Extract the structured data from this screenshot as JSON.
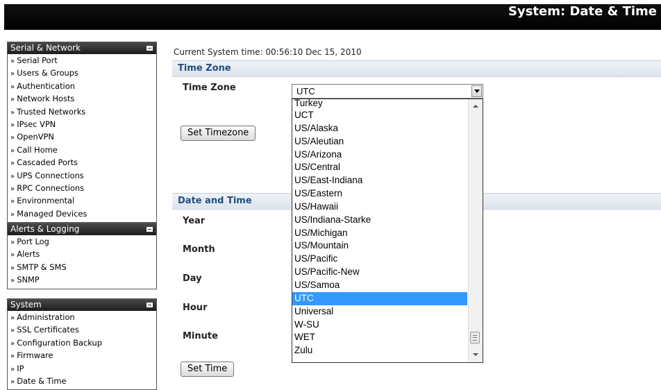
{
  "header": {
    "title": "System: Date & Time"
  },
  "sidebar": {
    "serial_network": {
      "title": "Serial & Network",
      "items": [
        "Serial Port",
        "Users & Groups",
        "Authentication",
        "Network Hosts",
        "Trusted Networks",
        "IPsec VPN",
        "OpenVPN",
        "Call Home",
        "Cascaded Ports",
        "UPS Connections",
        "RPC Connections",
        "Environmental",
        "Managed Devices"
      ]
    },
    "alerts_logging": {
      "title": "Alerts & Logging",
      "items": [
        "Port Log",
        "Alerts",
        "SMTP & SMS",
        "SNMP"
      ]
    },
    "system": {
      "title": "System",
      "items": [
        "Administration",
        "SSL Certificates",
        "Configuration Backup",
        "Firmware",
        "IP",
        "Date & Time"
      ]
    }
  },
  "main": {
    "current_time": "Current System time: 00:56:10 Dec 15, 2010",
    "timezone_section": "Time Zone",
    "timezone_label": "Time Zone",
    "timezone_value": "UTC",
    "set_timezone_button": "Set Timezone",
    "datetime_section": "Date and Time",
    "fields": [
      "Year",
      "Month",
      "Day",
      "Hour",
      "Minute"
    ],
    "set_time_button": "Set Time"
  },
  "timezone_options": [
    "Turkey",
    "UCT",
    "US/Alaska",
    "US/Aleutian",
    "US/Arizona",
    "US/Central",
    "US/East-Indiana",
    "US/Eastern",
    "US/Hawaii",
    "US/Indiana-Starke",
    "US/Michigan",
    "US/Mountain",
    "US/Pacific",
    "US/Pacific-New",
    "US/Samoa",
    "UTC",
    "Universal",
    "W-SU",
    "WET",
    "Zulu"
  ],
  "selected_option": "UTC",
  "colors": {
    "section_text": "#1f4e84",
    "selection": "#3399ff"
  }
}
